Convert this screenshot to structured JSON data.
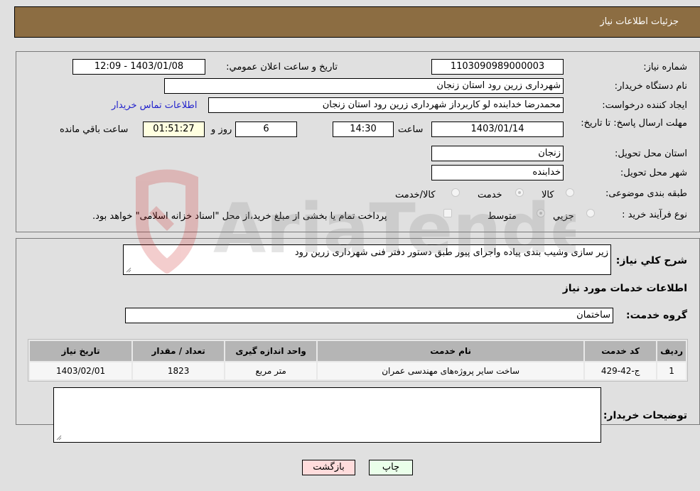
{
  "header": {
    "title": "جزئیات اطلاعات نیاز"
  },
  "details": {
    "need_number": {
      "label": "شماره نیاز:",
      "value": "1103090989000003"
    },
    "announce_datetime": {
      "label": "تاریخ و ساعت اعلان عمومي:",
      "value": "1403/01/08 - 12:09"
    },
    "buyer_org": {
      "label": "نام دستگاه خریدار:",
      "value": "شهرداری زرین رود استان زنجان"
    },
    "requester": {
      "label": "ایجاد کننده درخواست:",
      "value": "محمدرضا خدابنده لو کاربرداز شهرداری زرین رود استان زنجان"
    },
    "buyer_contact_link": "اطلاعات تماس خریدار",
    "deadline": {
      "label": "مهلت ارسال پاسخ: تا تاریخ:",
      "date": "1403/01/14",
      "time_label": "ساعت",
      "time": "14:30",
      "days": "6",
      "days_label": "روز و",
      "remaining": "01:51:27",
      "remaining_label": "ساعت باقي مانده"
    },
    "delivery_province": {
      "label": "استان محل تحویل:",
      "value": "زنجان"
    },
    "delivery_city": {
      "label": "شهر محل تحویل:",
      "value": "خدابنده"
    },
    "category": {
      "label": "طبقه بندی موضوعی:",
      "options": [
        "کالا",
        "خدمت",
        "کالا/خدمت"
      ],
      "selected": "خدمت"
    },
    "purchase_type": {
      "label": "نوع فرآیند خرید :",
      "options": [
        "جزيي",
        "متوسط"
      ],
      "selected": "متوسط",
      "treasury_note": "پرداخت تمام یا بخشی از مبلغ خرید،از محل \"اسناد خزانه اسلامی\" خواهد بود."
    }
  },
  "description": {
    "label": "شرح کلي نیاز:",
    "value": "زیر سازی وشیب بندی پیاده واجرای پیور طبق دستور دفتر فنی شهرداری زرین رود"
  },
  "services": {
    "section_title": "اطلاعات خدمات مورد نیاز",
    "group_label": "گروه خدمت:",
    "group_value": "ساختمان",
    "columns": [
      "ردیف",
      "کد خدمت",
      "نام خدمت",
      "واحد اندازه گیری",
      "تعداد / مقدار",
      "تاریخ نیاز"
    ],
    "rows": [
      [
        "1",
        "ج-42-429",
        "ساخت سایر پروژه‌های مهندسی عمران",
        "متر مربع",
        "1823",
        "1403/02/01"
      ]
    ]
  },
  "buyer_notes": {
    "label": "توضیحات خریدار:",
    "value": ""
  },
  "buttons": {
    "print": "چاپ",
    "back": "بازگشت"
  },
  "watermark": {
    "text": "AriaTender.neT"
  },
  "colors": {
    "header_bg": "#8c6d42",
    "print_bg": "#eaffea",
    "back_bg": "#ffdcdc",
    "link": "#2222cc"
  }
}
